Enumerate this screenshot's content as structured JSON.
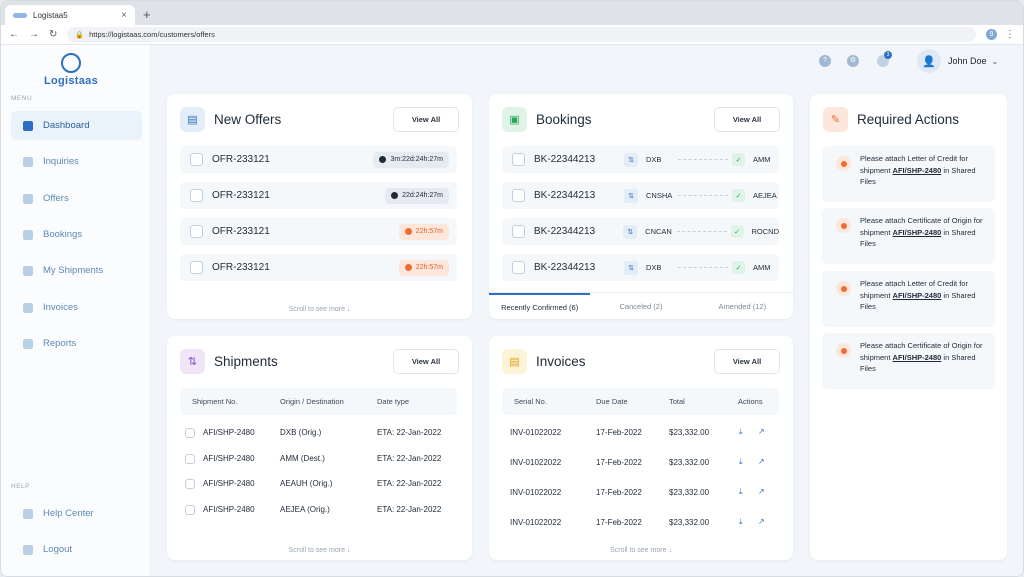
{
  "browser": {
    "tab_title": "Logistaa5",
    "url": "https://logistaas.com/customers/offers",
    "profile_initial": "9"
  },
  "sidebar": {
    "brand": "Logistaas",
    "menu_heading": "MENU",
    "items": [
      {
        "label": "Dashboard",
        "icon": "dashboard-icon",
        "active": true
      },
      {
        "label": "Inquiries",
        "icon": "inquiries-icon"
      },
      {
        "label": "Offers",
        "icon": "offers-icon"
      },
      {
        "label": "Bookings",
        "icon": "bookings-icon"
      },
      {
        "label": "My Shipments",
        "icon": "shipments-icon"
      },
      {
        "label": "Invoices",
        "icon": "invoices-icon"
      },
      {
        "label": "Reports",
        "icon": "reports-icon"
      }
    ],
    "help_heading": "HELP",
    "help_items": [
      {
        "label": "Help Center",
        "icon": "help-icon"
      },
      {
        "label": "Logout",
        "icon": "logout-icon"
      }
    ]
  },
  "topbar": {
    "notification_count": "3",
    "user_name": "John Doe"
  },
  "new_offers": {
    "title": "New Offers",
    "view_all": "View All",
    "rows": [
      {
        "id": "OFR-233121",
        "timer": "3m:22d:24h:27m",
        "style": "grey"
      },
      {
        "id": "OFR-233121",
        "timer": "22d:24h:27m",
        "style": "grey"
      },
      {
        "id": "OFR-233121",
        "timer": "22h:57m",
        "style": "orange"
      },
      {
        "id": "OFR-233121",
        "timer": "22h:57m",
        "style": "orange"
      }
    ],
    "scroll_hint": "Scroll to see more"
  },
  "bookings": {
    "title": "Bookings",
    "view_all": "View All",
    "rows": [
      {
        "id": "BK-22344213",
        "origin": "DXB",
        "dest": "AMM"
      },
      {
        "id": "BK-22344213",
        "origin": "CNSHA",
        "dest": "AEJEA"
      },
      {
        "id": "BK-22344213",
        "origin": "CNCAN",
        "dest": "ROCND"
      },
      {
        "id": "BK-22344213",
        "origin": "DXB",
        "dest": "AMM"
      }
    ],
    "tabs": [
      "Recently Confirmed (6)",
      "Canceled (2)",
      "Amended (12)"
    ]
  },
  "required_actions": {
    "title": "Required Actions",
    "items": [
      {
        "pre": "Please attach Letter of Credit for shipment ",
        "link": "AFI/SHP-2480",
        "post": " in Shared Files"
      },
      {
        "pre": "Please attach Certificate of Origin for shipment ",
        "link": "AFI/SHP-2480",
        "post": " in Shared Files"
      },
      {
        "pre": "Please attach Letter of Credit for shipment ",
        "link": "AFI/SHP-2480",
        "post": " in Shared Files"
      },
      {
        "pre": "Please attach Certificate of Origin for shipment ",
        "link": "AFI/SHP-2480",
        "post": " in Shared Files"
      }
    ]
  },
  "shipments": {
    "title": "Shipments",
    "view_all": "View All",
    "headers": [
      "Shipment No.",
      "Origin / Destination",
      "Date type"
    ],
    "rows": [
      [
        "AFI/SHP-2480",
        "DXB (Orig.)",
        "ETA: 22-Jan-2022"
      ],
      [
        "AFI/SHP-2480",
        "AMM (Dest.)",
        "ETA: 22-Jan-2022"
      ],
      [
        "AFI/SHP-2480",
        "AEAUH (Orig.)",
        "ETA: 22-Jan-2022"
      ],
      [
        "AFI/SHP-2480",
        "AEJEA (Orig.)",
        "ETA: 22-Jan-2022"
      ]
    ],
    "scroll_hint": "Scroll to see more"
  },
  "invoices": {
    "title": "Invoices",
    "view_all": "View All",
    "headers": [
      "Serial No.",
      "Due Date",
      "Total",
      "Actions"
    ],
    "rows": [
      [
        "INV-01022022",
        "17-Feb-2022",
        "$23,332.00"
      ],
      [
        "INV-01022022",
        "17-Feb-2022",
        "$23,332.00"
      ],
      [
        "INV-01022022",
        "17-Feb-2022",
        "$23,332.00"
      ],
      [
        "INV-01022022",
        "17-Feb-2022",
        "$23,332.00"
      ]
    ],
    "scroll_hint": "Scroll to see more"
  },
  "colors": {
    "accent": "#2d6fc4",
    "warning": "#ef6c35",
    "success": "#27a559"
  }
}
